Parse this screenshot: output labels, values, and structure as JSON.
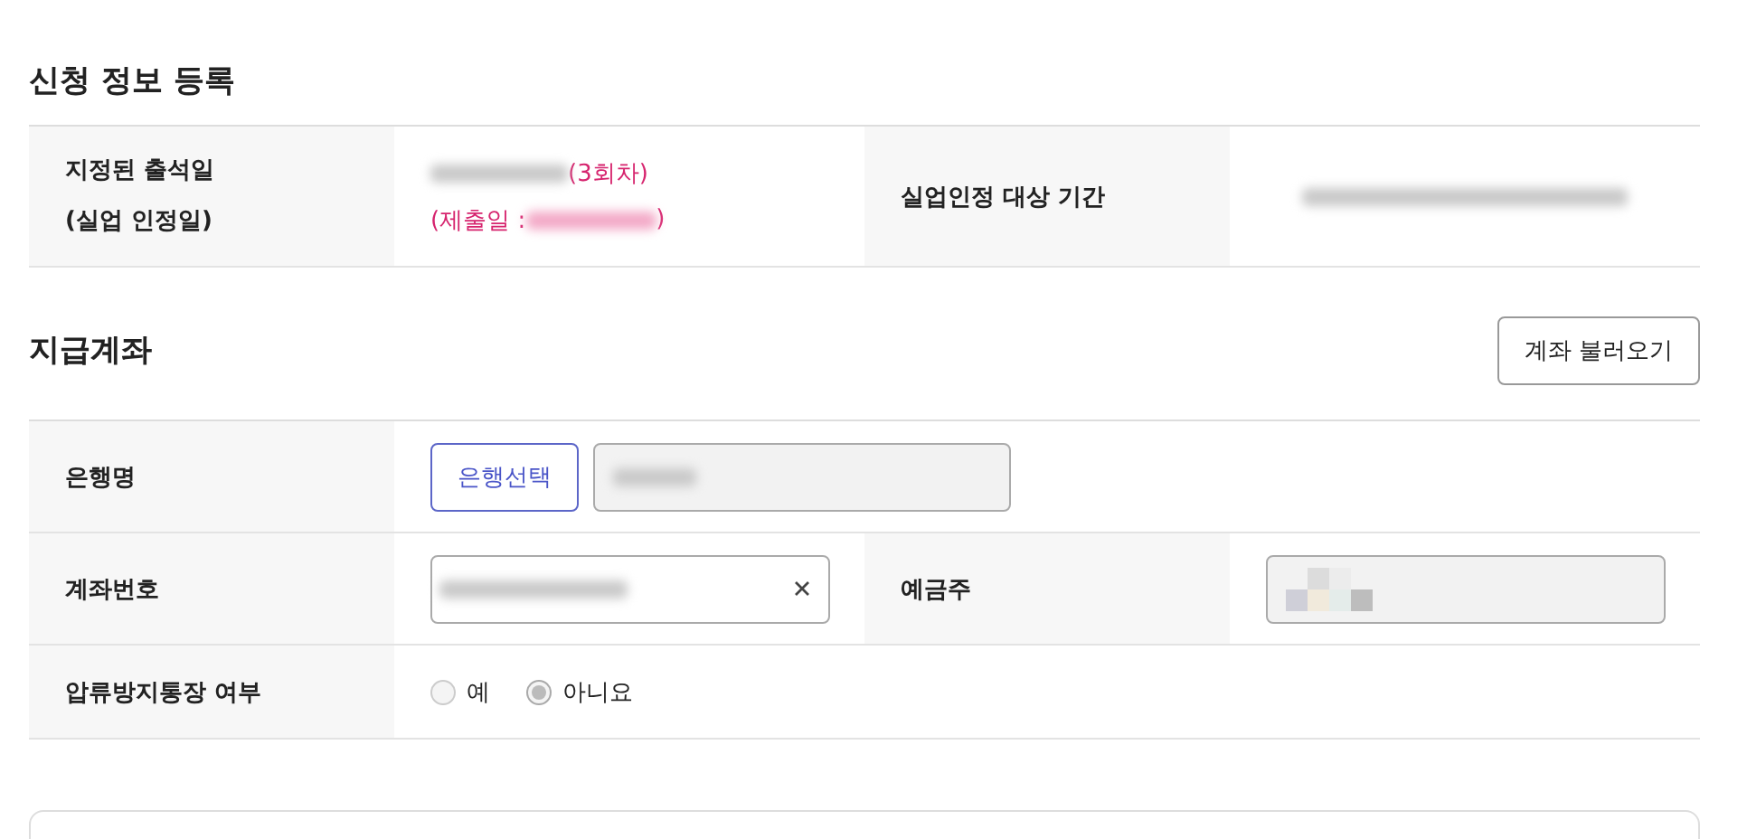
{
  "application_info": {
    "title": "신청 정보 등록",
    "attendance_label_lines": [
      "지정된 출석일",
      "(실업 인정일)"
    ],
    "round": "(3회차)",
    "submission_prefix": "(제출일 : ",
    "submission_suffix": ")",
    "period_label": "실업인정 대상 기간"
  },
  "payment_account": {
    "title": "지급계좌",
    "load_button": "계좌 불러오기",
    "bank_label": "은행명",
    "bank_select_button": "은행선택",
    "account_label": "계좌번호",
    "holder_label": "예금주",
    "seizure_label": "압류방지통장 여부",
    "options": [
      {
        "label": "예",
        "selected": false
      },
      {
        "label": "아니요",
        "selected": true
      }
    ]
  }
}
